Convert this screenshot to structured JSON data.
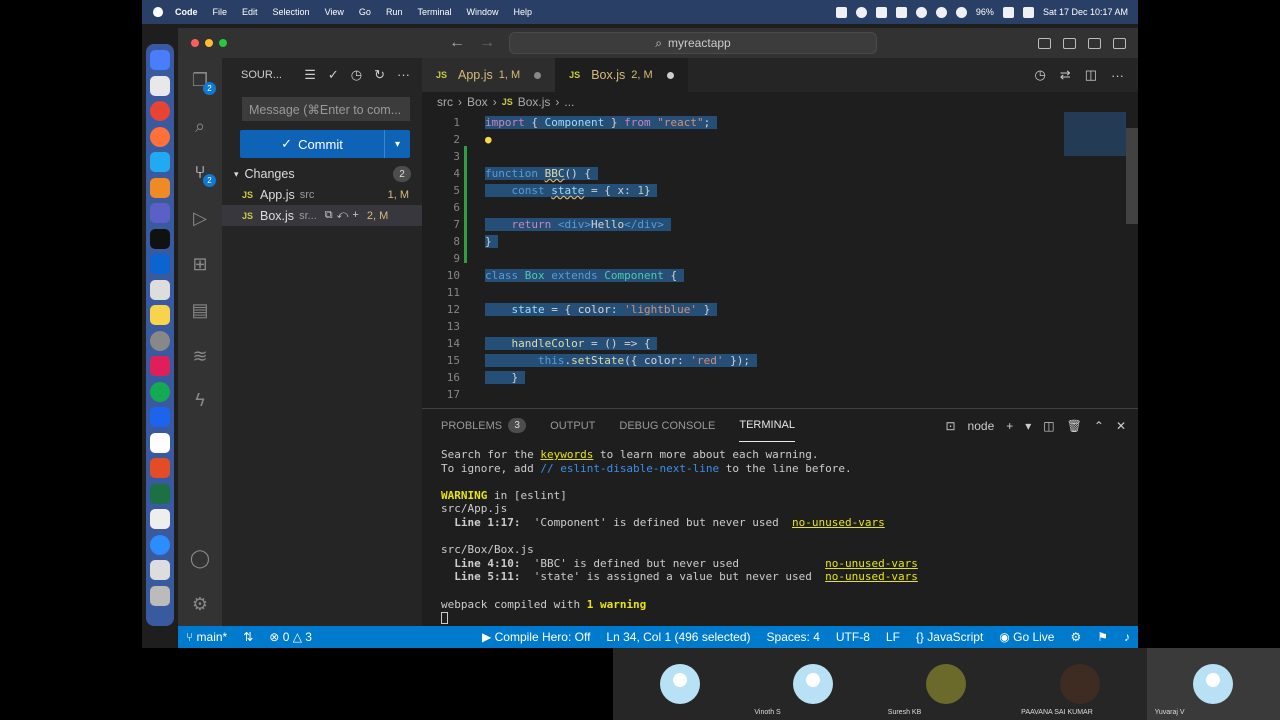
{
  "menubar": {
    "app": "Code",
    "items": [
      "File",
      "Edit",
      "Selection",
      "View",
      "Go",
      "Run",
      "Terminal",
      "Window",
      "Help"
    ],
    "battery": "96%",
    "datetime": "Sat 17 Dec  10:17 AM"
  },
  "titlebar": {
    "search": "myreactapp"
  },
  "activity": {
    "scm_badge": "2",
    "run_badge": "2"
  },
  "sidebar": {
    "title": "SOUR...",
    "message_placeholder": "Message (⌘Enter to com...",
    "commit_label": "Commit",
    "changes_label": "Changes",
    "changes_count": "2",
    "files": [
      {
        "name": "App.js",
        "dir": "src",
        "status": "1, M"
      },
      {
        "name": "Box.js",
        "dir": "sr...",
        "status": "2, M"
      }
    ]
  },
  "tabs": [
    {
      "name": "App.js",
      "status": "1, M"
    },
    {
      "name": "Box.js",
      "status": "2, M"
    }
  ],
  "breadcrumb": [
    "src",
    "Box",
    "Box.js",
    "..."
  ],
  "code": {
    "l1a": "import",
    "l1b": "{ ",
    "l1c": "Component",
    "l1d": " } ",
    "l1e": "from",
    "l1f": "\"react\"",
    "l1g": ";",
    "l4a": "function",
    "l4b": "BBC",
    "l4c": "() {",
    "l5a": "const",
    "l5b": "state",
    "l5c": " = { x: ",
    "l5d": "1",
    "l5e": "}",
    "l7a": "return",
    "l7b": "<div>",
    "l7c": "Hello",
    "l7d": "</div>",
    "l8": "}",
    "l10a": "class",
    "l10b": "Box",
    "l10c": "extends",
    "l10d": "Component",
    "l10e": " {",
    "l12a": "state",
    "l12b": " = { color: ",
    "l12c": "'lightblue'",
    "l12d": " }",
    "l14a": "handleColor",
    "l14b": " = () => {",
    "l15a": "this",
    "l15b": ".",
    "l15c": "setState",
    "l15d": "({ color: ",
    "l15e": "'red'",
    "l15f": " });",
    "l16": "}"
  },
  "panel": {
    "tabs": [
      "PROBLEMS",
      "OUTPUT",
      "DEBUG CONSOLE",
      "TERMINAL"
    ],
    "problems_count": "3",
    "shell": "node",
    "t1a": "Search for the ",
    "t1b": "keywords",
    "t1c": " to learn more about each warning.",
    "t2a": "To ignore, add ",
    "t2b": "// eslint-disable-next-line",
    "t2c": " to the line before.",
    "t4a": "WARNING",
    "t4b": " in [eslint]",
    "t5": "src/App.js",
    "t6a": "  Line 1:17:",
    "t6b": "  'Component' is defined but never used  ",
    "t6c": "no-unused-vars",
    "t8": "src/Box/Box.js",
    "t9a": "  Line 4:10:",
    "t9b": "  'BBC' is defined but never used             ",
    "t9c": "no-unused-vars",
    "t10a": "  Line 5:11:",
    "t10b": "  'state' is assigned a value but never used  ",
    "t10c": "no-unused-vars",
    "t12a": "webpack compiled with ",
    "t12b": "1 warning"
  },
  "status": {
    "branch": "main*",
    "errors": "0",
    "warnings": "3",
    "compile": "Compile Hero: Off",
    "position": "Ln 34, Col 1 (496 selected)",
    "spaces": "Spaces: 4",
    "encoding": "UTF-8",
    "eol": "LF",
    "language": "JavaScript",
    "golive": "Go Live"
  },
  "participants": [
    "",
    "Vinoth S",
    "Suresh KB",
    "PAAVANA SAI KUMAR",
    "Yuvaraj V"
  ],
  "colors": {
    "accent": "#007acc",
    "selection": "#264f78"
  }
}
